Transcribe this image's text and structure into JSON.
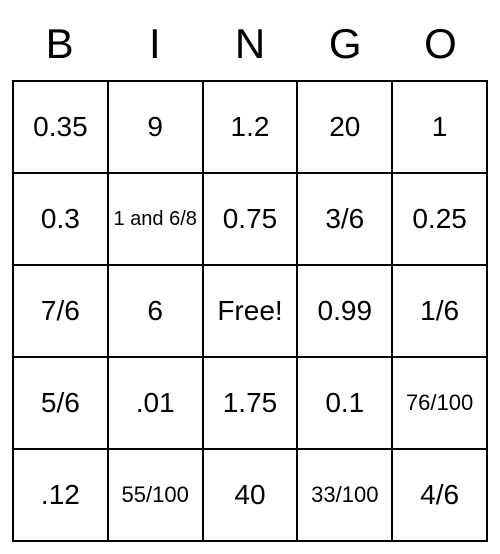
{
  "bingo": {
    "headers": [
      "B",
      "I",
      "N",
      "G",
      "O"
    ],
    "cells": [
      {
        "value": "0.35",
        "size": "normal"
      },
      {
        "value": "9",
        "size": "normal"
      },
      {
        "value": "1.2",
        "size": "normal"
      },
      {
        "value": "20",
        "size": "normal"
      },
      {
        "value": "1",
        "size": "normal"
      },
      {
        "value": "0.3",
        "size": "normal"
      },
      {
        "value": "1 and 6/8",
        "size": "small"
      },
      {
        "value": "0.75",
        "size": "normal"
      },
      {
        "value": "3/6",
        "size": "normal"
      },
      {
        "value": "0.25",
        "size": "normal"
      },
      {
        "value": "7/6",
        "size": "normal"
      },
      {
        "value": "6",
        "size": "normal"
      },
      {
        "value": "Free!",
        "size": "normal"
      },
      {
        "value": "0.99",
        "size": "normal"
      },
      {
        "value": "1/6",
        "size": "normal"
      },
      {
        "value": "5/6",
        "size": "normal"
      },
      {
        "value": ".01",
        "size": "normal"
      },
      {
        "value": "1.75",
        "size": "normal"
      },
      {
        "value": "0.1",
        "size": "normal"
      },
      {
        "value": "76/100",
        "size": "medium"
      },
      {
        "value": ".12",
        "size": "normal"
      },
      {
        "value": "55/100",
        "size": "medium"
      },
      {
        "value": "40",
        "size": "normal"
      },
      {
        "value": "33/100",
        "size": "medium"
      },
      {
        "value": "4/6",
        "size": "normal"
      }
    ]
  }
}
